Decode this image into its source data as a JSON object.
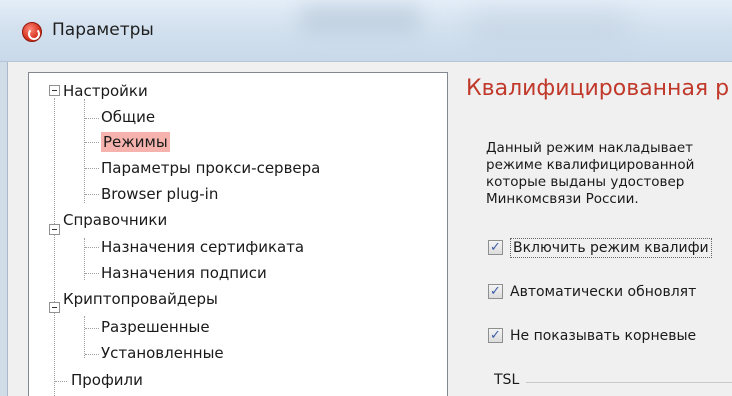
{
  "window": {
    "title": "Параметры",
    "icon": "app-logo-icon"
  },
  "tree": {
    "nodes": [
      {
        "label": "Настройки",
        "level": 0,
        "expanded": true
      },
      {
        "label": "Общие",
        "level": 1
      },
      {
        "label": "Режимы",
        "level": 1,
        "selected": true
      },
      {
        "label": "Параметры прокси-сервера",
        "level": 1
      },
      {
        "label": "Browser plug-in",
        "level": 1
      },
      {
        "label": "Справочники",
        "level": 0,
        "expanded": true
      },
      {
        "label": "Назначения сертификата",
        "level": 1
      },
      {
        "label": "Назначения подписи",
        "level": 1
      },
      {
        "label": "Криптопровайдеры",
        "level": 0,
        "expanded": true
      },
      {
        "label": "Разрешенные",
        "level": 1
      },
      {
        "label": "Установленные",
        "level": 1
      },
      {
        "label": "Профили",
        "level": 0
      }
    ]
  },
  "panel": {
    "heading": "Квалифицированная р",
    "description": "Данный режим накладывает\nрежиме квалифицированной\nкоторые выданы удостовер\nМинкомсвязи России.",
    "checkboxes": [
      {
        "label": "Включить режим квалифи",
        "checked": true
      },
      {
        "label": "Автоматически обновлят",
        "checked": true
      },
      {
        "label": "Не показывать корневые",
        "checked": true
      }
    ],
    "tsl_label": "TSL"
  },
  "colors": {
    "selection": "#f6b3ad",
    "heading": "#c0392b",
    "titlebar": "#d3e1ef"
  }
}
